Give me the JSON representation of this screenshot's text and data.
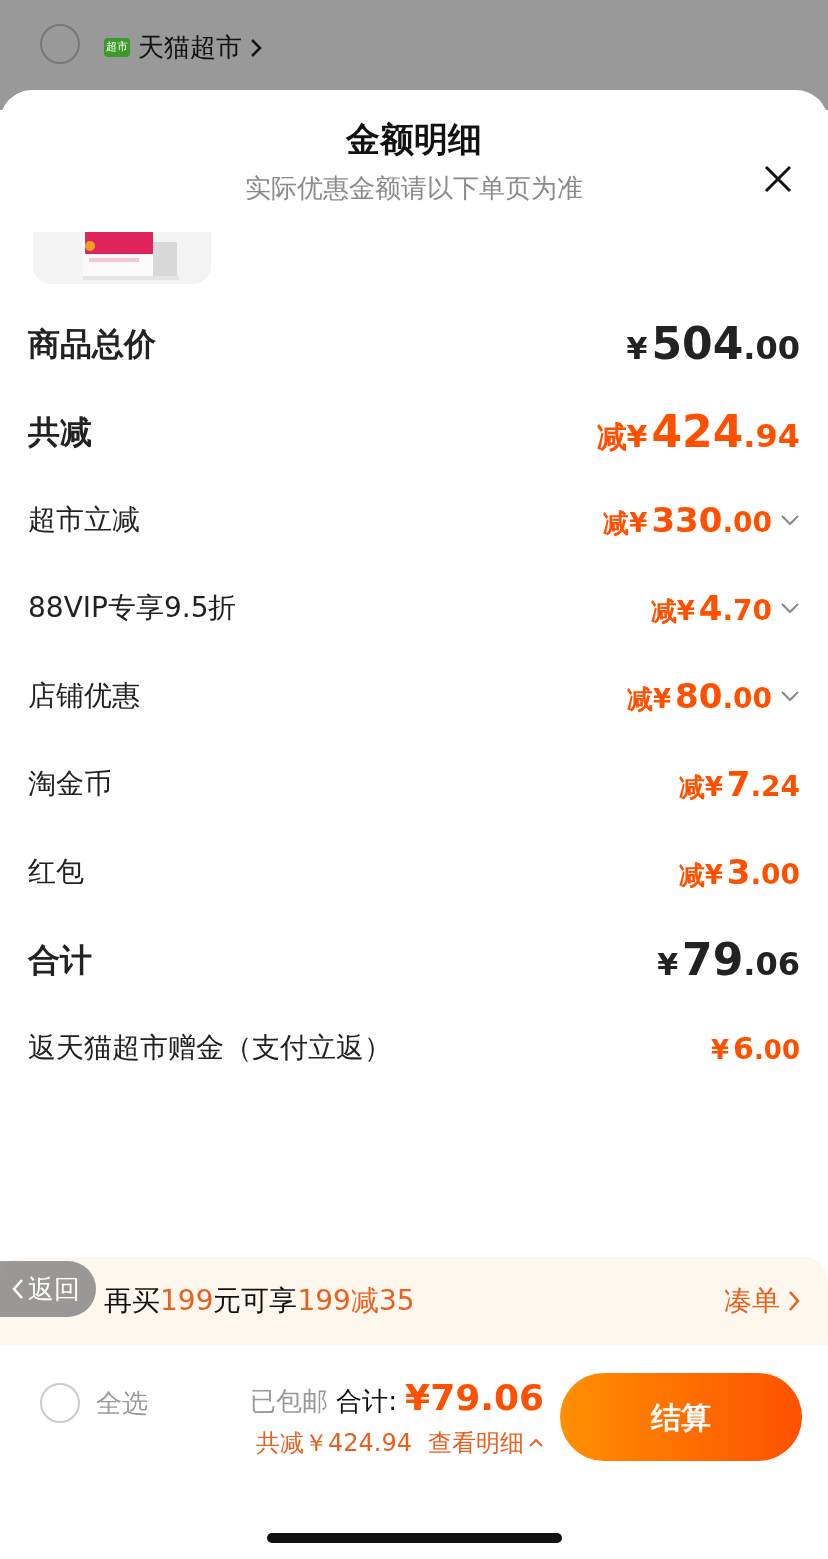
{
  "store": {
    "name": "天猫超市",
    "badge": "超市",
    "selected": false
  },
  "sheet": {
    "title": "金额明细",
    "subtitle": "实际优惠金额请以下单页为准"
  },
  "rows": [
    {
      "kind": "total",
      "label": "商品总价",
      "prefix": "",
      "amount": "¥504.00",
      "expandable": false
    },
    {
      "kind": "discount_total",
      "label": "共减",
      "prefix": "减",
      "amount": "¥424.94",
      "expandable": false
    },
    {
      "kind": "discount",
      "label": "超市立减",
      "prefix": "减",
      "amount": "¥330.00",
      "expandable": true
    },
    {
      "kind": "discount",
      "label": "88VIP专享9.5折",
      "prefix": "减",
      "amount": "¥4.70",
      "expandable": true
    },
    {
      "kind": "discount",
      "label": "店铺优惠",
      "prefix": "减",
      "amount": "¥80.00",
      "expandable": true
    },
    {
      "kind": "discount",
      "label": "淘金币",
      "prefix": "减",
      "amount": "¥7.24",
      "expandable": false
    },
    {
      "kind": "discount",
      "label": "红包",
      "prefix": "减",
      "amount": "¥3.00",
      "expandable": false
    },
    {
      "kind": "total",
      "label": "合计",
      "prefix": "",
      "amount": "¥79.06",
      "expandable": false
    },
    {
      "kind": "rebate",
      "label": "返天猫超市赠金（支付立返）",
      "prefix": "",
      "amount": "¥6.00",
      "expandable": false
    }
  ],
  "banner": {
    "text": "再买**199**元可享**199减35**",
    "link": "凑单"
  },
  "back": {
    "label": "返回"
  },
  "footer": {
    "select_all": "全选",
    "selected": false,
    "shipping": "已包邮",
    "total_label": "合计:",
    "total": "¥79.06",
    "saved": "共减￥424.94",
    "details": "查看明细",
    "checkout": "结算"
  }
}
